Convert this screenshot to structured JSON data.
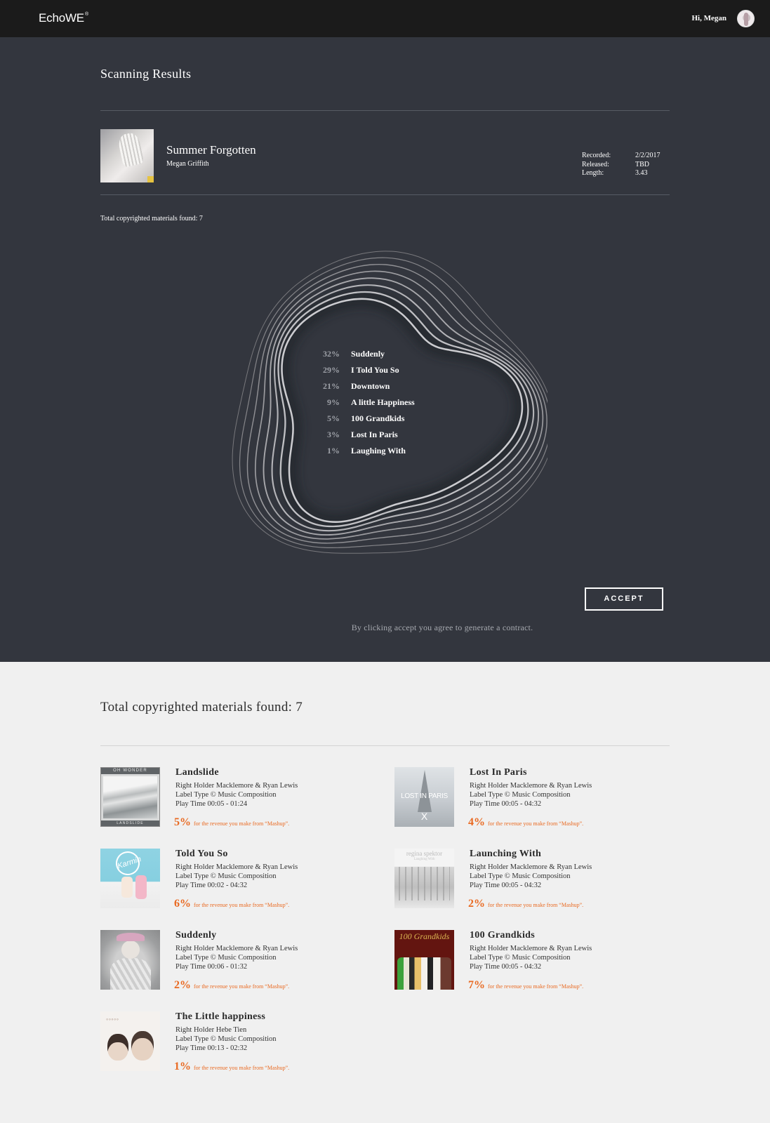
{
  "nav": {
    "logo": "EchoWE",
    "logo_mark": "®",
    "greeting": "Hi, Megan"
  },
  "scan": {
    "title": "Scanning Results",
    "track": {
      "title": "Summer Forgotten",
      "artist": "Megan Griffith",
      "meta": [
        {
          "label": "Recorded:",
          "value": "2/2/2017"
        },
        {
          "label": "Released:",
          "value": "TBD"
        },
        {
          "label": "Length:",
          "value": "3.43"
        }
      ]
    },
    "found_label": "Total copyrighted materials found: 7",
    "results": [
      {
        "pct": "32%",
        "name": "Suddenly"
      },
      {
        "pct": "29%",
        "name": "I Told You So"
      },
      {
        "pct": "21%",
        "name": "Downtown"
      },
      {
        "pct": "9%",
        "name": "A little Happiness"
      },
      {
        "pct": "5%",
        "name": "100 Grandkids"
      },
      {
        "pct": "3%",
        "name": "Lost In Paris"
      },
      {
        "pct": "1%",
        "name": "Laughing With"
      }
    ],
    "accept_label": "ACCEPT",
    "accept_note": "By clicking accept you agree to generate a contract."
  },
  "materials": {
    "title": "Total copyrighted materials found: 7",
    "share_text": "for the revenue you make from “Mashup”.",
    "items": [
      {
        "title": "Landslide",
        "holder": "Right Holder Macklemore & Ryan Lewis",
        "label_type": "Label Type © Music Composition",
        "play_time": "Play Time 00:05 - 01:24",
        "share": "5%",
        "cover_top": "OH WONDER",
        "cover_bottom": "LANDSLIDE"
      },
      {
        "title": "Lost In Paris",
        "holder": "Right Holder Macklemore & Ryan Lewis",
        "label_type": "Label Type © Music Composition",
        "play_time": "Play Time 00:05 - 04:32",
        "share": "4%",
        "cover_text": "LOST IN PARIS",
        "cover_mark": "X"
      },
      {
        "title": "Told You So",
        "holder": "Right Holder Macklemore & Ryan Lewis",
        "label_type": "Label Type © Music Composition",
        "play_time": "Play Time 00:02 - 04:32",
        "share": "6%",
        "cover_text": "Karmin"
      },
      {
        "title": "Launching With",
        "holder": "Right Holder Macklemore & Ryan Lewis",
        "label_type": "Label Type © Music Composition",
        "play_time": "Play Time 00:05 - 04:32",
        "share": "2%",
        "cover_text": "regina spektor",
        "cover_sub": "Laughing With"
      },
      {
        "title": "Suddenly",
        "holder": "Right Holder Macklemore & Ryan Lewis",
        "label_type": "Label Type © Music Composition",
        "play_time": "Play Time 00:06 - 01:32",
        "share": "2%"
      },
      {
        "title": "100 Grandkids",
        "holder": "Right Holder Macklemore & Ryan Lewis",
        "label_type": "Label Type © Music Composition",
        "play_time": "Play Time 00:05 - 04:32",
        "share": "7%",
        "cover_text": "100 Grandkids"
      },
      {
        "title": "The Little happiness",
        "holder": "Right Holder Hebe Tien",
        "label_type": "Label Type © Music Composition",
        "play_time": "Play Time 00:13 - 02:32",
        "share": "1%"
      }
    ]
  },
  "colors": {
    "nav_bg": "#1b1b1b",
    "dark_bg": "#33363e",
    "light_bg": "#f0f0f0",
    "accent": "#e96a22"
  }
}
